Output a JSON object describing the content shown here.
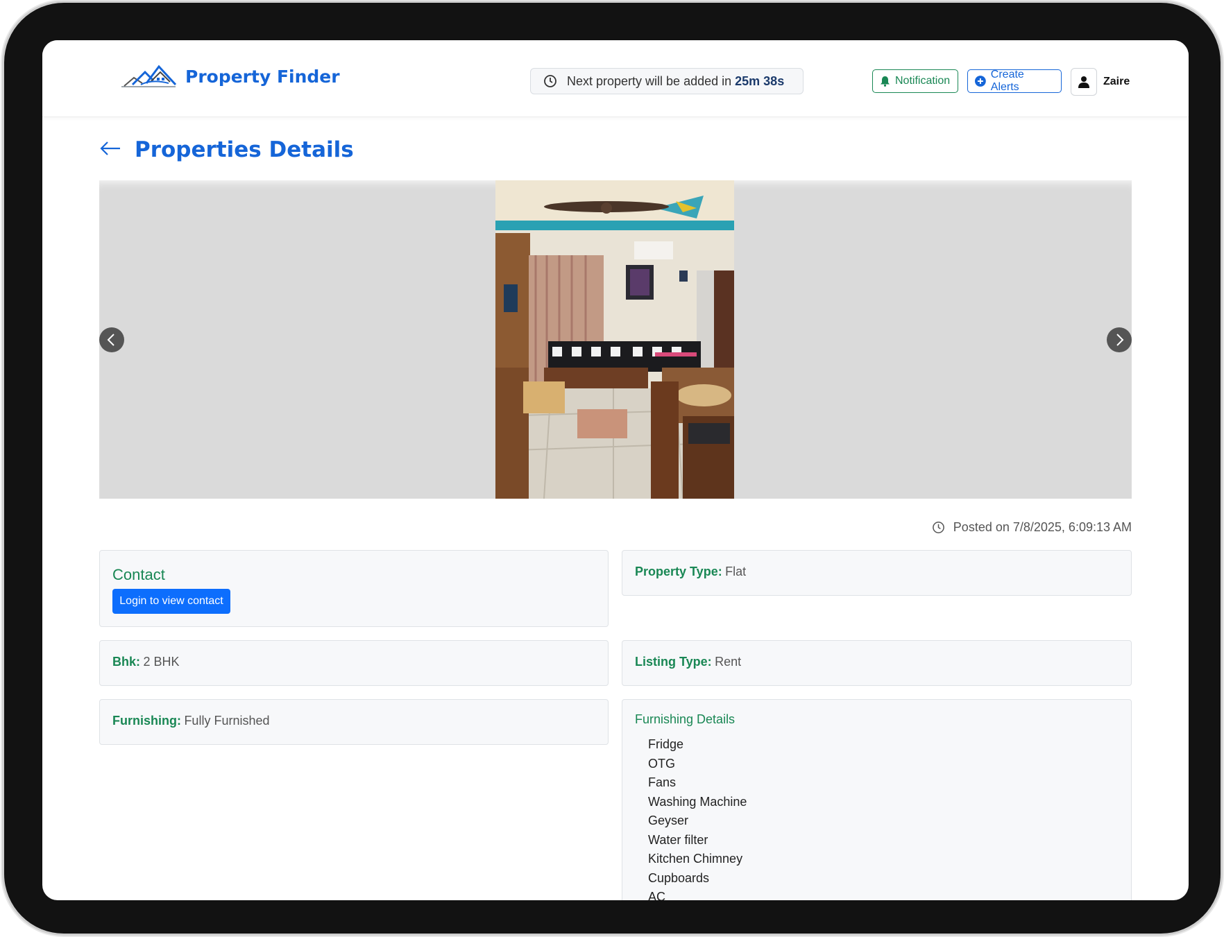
{
  "header": {
    "brand": "Property Finder",
    "timer_prefix": "Next property will be added in",
    "timer_value": "25m 38s",
    "notification_label": "Notification",
    "create_alerts_label": "Create Alerts",
    "user_name": "Zaire"
  },
  "page": {
    "title": "Properties Details",
    "posted": "Posted on 7/8/2025, 6:09:13 AM"
  },
  "contact": {
    "title": "Contact",
    "login_label": "Login to view contact"
  },
  "details": {
    "property_type_label": "Property Type:",
    "property_type_value": "Flat",
    "bhk_label": "Bhk:",
    "bhk_value": "2 BHK",
    "listing_type_label": "Listing Type:",
    "listing_type_value": "Rent",
    "furnishing_label": "Furnishing:",
    "furnishing_value": "Fully Furnished"
  },
  "furnishing_details": {
    "title": "Furnishing Details",
    "items": [
      "Fridge",
      "OTG",
      "Fans",
      "Washing Machine",
      "Geyser",
      "Water filter",
      "Kitchen Chimney",
      "Cupboards",
      "AC"
    ]
  },
  "colors": {
    "brand_blue": "#1565d8",
    "success_green": "#198754",
    "primary_button": "#0d6efd"
  },
  "icons": {
    "logo": "house-roof-logo-icon",
    "timer": "clock-icon",
    "notification": "bell-icon",
    "alerts": "plus-circle-icon",
    "user": "person-icon",
    "back": "arrow-left-icon",
    "prev": "chevron-left-icon",
    "next": "chevron-right-icon"
  }
}
